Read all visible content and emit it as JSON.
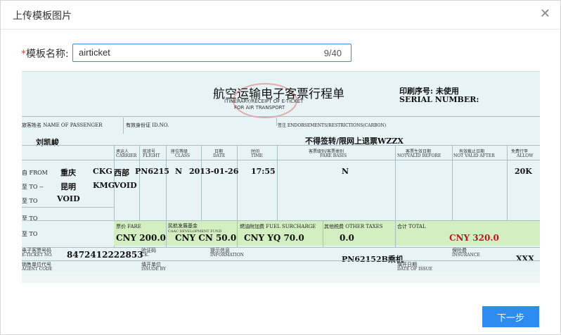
{
  "dialog": {
    "title": "上传模板图片",
    "close_icon": "close-icon"
  },
  "form": {
    "required_mark": "*",
    "name_label": "模板名称:",
    "name_value": "airticket",
    "counter": "9/40"
  },
  "ticket": {
    "title_cn": "航空运输电子客票行程单",
    "title_en1": "ITINERARY/RECEIPT OF E-TICKET",
    "title_en2": "FOR AIR TRANSPORT",
    "serial_cn": "印刷序号: 未使用",
    "serial_en": "SERIAL NUMBER:",
    "passenger_label": "旅客姓名 NAME OF PASSENGER",
    "id_label": "有效身份证 ID.NO.",
    "endorse_label": "签注 ENDORSEMENTS/RESTRICTIONS(CARBON)",
    "passenger_name": "刘凯峻",
    "endorse_value": "不得签转/限网上退票WZZX",
    "columns": [
      {
        "cn": "承运人",
        "en": "CARRIER"
      },
      {
        "cn": "航班号",
        "en": "FLIGHT"
      },
      {
        "cn": "座位等级",
        "en": "CLASS"
      },
      {
        "cn": "日期",
        "en": "DATE"
      },
      {
        "cn": "时间",
        "en": "TIME"
      },
      {
        "cn": "客票级别/客票类别",
        "en": "FARE BASIS"
      },
      {
        "cn": "客票生效日期",
        "en": "NOTVALID BEFORE"
      },
      {
        "cn": "有效截止日期",
        "en": "NOT VALID AFTER"
      },
      {
        "cn": "免费行李",
        "en": "ALLOW"
      }
    ],
    "from_label": "自 FROM",
    "to_label": "至 TO",
    "to_label_dash": "至 TO --",
    "row1": {
      "city": "重庆",
      "code": "CKG",
      "carrier": "西部",
      "flight": "PN6215",
      "class": "N",
      "date": "2013-01-26",
      "time": "17:55",
      "fare_basis": "N",
      "allow": "20K"
    },
    "row2": {
      "city": "昆明",
      "code": "KMG",
      "carrier": "VOID"
    },
    "row3": {
      "city": "VOID"
    },
    "fare_label": "票价 FARE",
    "fare_value": "CNY  200.0",
    "caac_label": "民航发展基金",
    "caac_label_en": "CAAC DEVELOPMENT FUND",
    "caac_value": "CNY CN  50.0",
    "fuel_label": "燃油附加费 FUEL SURCHARGE",
    "fuel_value": "CNY YQ  70.0",
    "other_label": "其他税费 OTHER TAXES",
    "other_value": "0.0",
    "total_label": "合计 TOTAL",
    "total_value": "CNY  320.0",
    "eticket_label": "电子客票号码",
    "eticket_label_en": "E-TICKET NO.",
    "eticket_value": "8472412222853",
    "ck_label": "验证码",
    "ck_label_en": "CK.",
    "info_label": "提示信息",
    "info_label_en": "INFORMATION",
    "info_value": "PN62152B乘机",
    "insurance_label": "保险费",
    "insurance_label_en": "INSURANCE",
    "insurance_value": "XXX",
    "agent_label": "销售单位代号",
    "agent_label_en": "AGENT CODE",
    "issued_label": "填开单位",
    "issued_label_en": "ISSUDE BY",
    "date_issue_label": "填开日期",
    "date_issue_label_en": "DATE OF ISSUE"
  },
  "actions": {
    "next_label": "下一步"
  }
}
